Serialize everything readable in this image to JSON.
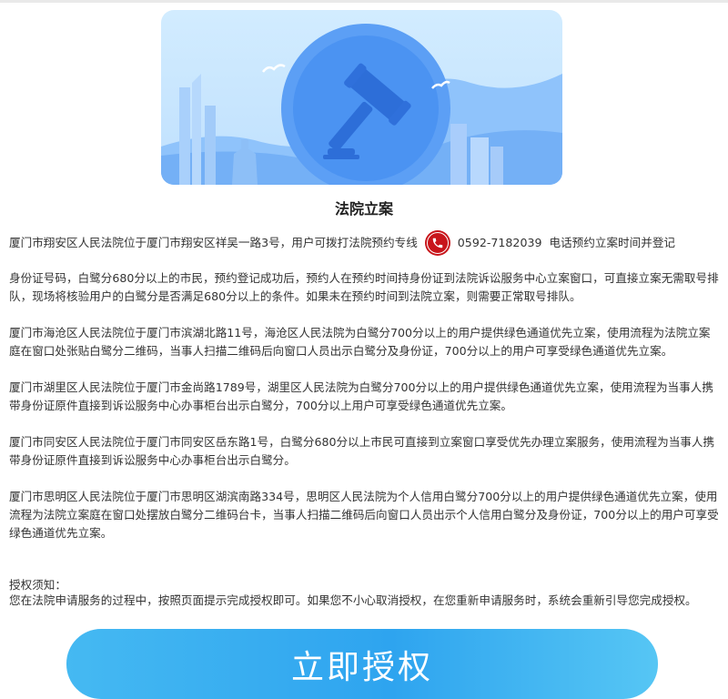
{
  "page": {
    "title": "法院立案"
  },
  "intro": {
    "line1_before": "厦门市翔安区人民法院位于厦门市翔安区祥吴一路3号，用户可拨打法院预约专线",
    "phone": "0592-7182039",
    "line1_after": "电话预约立案时间并登记",
    "continuation": "身份证号码，白鹭分680分以上的市民，预约登记成功后，预约人在预约时间持身份证到法院诉讼服务中心立案窗口，可直接立案无需取号排队，现场将核验用户的白鹭分是否满足680分以上的条件。如果未在预约时间到法院立案，则需要正常取号排队。"
  },
  "paragraphs": [
    "厦门市海沧区人民法院位于厦门市滨湖北路11号，海沧区人民法院为白鹭分700分以上的用户提供绿色通道优先立案，使用流程为法院立案庭在窗口处张贴白鹭分二维码，当事人扫描二维码后向窗口人员出示白鹭分及身份证，700分以上的用户可享受绿色通道优先立案。",
    "厦门市湖里区人民法院位于厦门市金尚路1789号，湖里区人民法院为白鹭分700分以上的用户提供绿色通道优先立案，使用流程为当事人携带身份证原件直接到诉讼服务中心办事柜台出示白鹭分，700分以上用户可享受绿色通道优先立案。",
    "厦门市同安区人民法院位于厦门市同安区岳东路1号，白鹭分680分以上市民可直接到立案窗口享受优先办理立案服务，使用流程为当事人携带身份证原件直接到诉讼服务中心办事柜台出示白鹭分。",
    "厦门市思明区人民法院位于厦门市思明区湖滨南路334号，思明区人民法院为个人信用白鹭分700分以上的用户提供绿色通道优先立案，使用流程为法院立案庭在窗口处摆放白鹭分二维码台卡，当事人扫描二维码后向窗口人员出示个人信用白鹭分及身份证，700分以上的用户可享受绿色通道优先立案。"
  ],
  "notice": {
    "title": "授权须知：",
    "text": "您在法院申请服务的过程中，按照页面提示完成授权即可。如果您不小心取消授权，在您重新申请服务时，系统会重新引导您完成授权。"
  },
  "button": {
    "label": "立即授权"
  },
  "icons": {
    "banner": "gavel-illustration",
    "phone": "phone-icon"
  },
  "colors": {
    "button": "#2ea4ef",
    "phone_icon": "#c8151b",
    "banner_bg": "#c9e6fe"
  }
}
